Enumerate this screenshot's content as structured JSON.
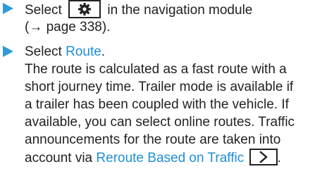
{
  "steps": [
    {
      "lines": {
        "l1_before": "Select",
        "l1_after": "in the navigation module",
        "l2": "(→ page 338)."
      },
      "icon": "gear-icon"
    },
    {
      "lines": {
        "l1_before": "Select",
        "l1_link": "Route",
        "l1_after": ".",
        "body": [
          "The route is calculated as a fast route with a",
          "short journey time. Trailer mode is available if",
          "a trailer has been coupled with the vehicle. If",
          "available, you can select online routes. Traffic",
          "announcements for the route are taken into"
        ],
        "last_before": "account via",
        "last_link": "Reroute Based on Traffic",
        "last_after": "."
      },
      "icon": "chevron-right-icon"
    }
  ],
  "colors": {
    "bullet": "#2f9ad6",
    "link": "#1f8fd6",
    "text": "#222222"
  }
}
